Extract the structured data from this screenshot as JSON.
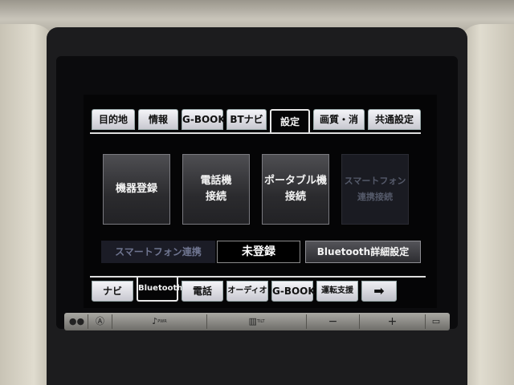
{
  "top_tabs": [
    {
      "label": "目的地",
      "active": false
    },
    {
      "label": "情報",
      "active": false
    },
    {
      "label": "G-BOOK",
      "active": false
    },
    {
      "label": "BTナビ",
      "active": false
    },
    {
      "label": "設定",
      "active": true
    },
    {
      "label": "画質・消",
      "active": false
    },
    {
      "label": "共通設定",
      "active": false
    }
  ],
  "main_buttons": [
    {
      "label": "機器登録",
      "enabled": true
    },
    {
      "label": "電話機\n接続",
      "enabled": true
    },
    {
      "label": "ポータブル機\n接続",
      "enabled": true
    },
    {
      "label": "スマートフォン\n連携接続",
      "enabled": false
    }
  ],
  "status": {
    "label": "スマートフォン連携",
    "value": "未登録",
    "detail_button": "Bluetooth詳細設定"
  },
  "bottom_tabs": [
    {
      "label": "ナビ",
      "active": false
    },
    {
      "label": "Bluetooth",
      "active": true
    },
    {
      "label": "電話",
      "active": false
    },
    {
      "label": "オーディオ",
      "active": false
    },
    {
      "label": "G-BOOK",
      "active": false
    },
    {
      "label": "運転支援",
      "active": false
    },
    {
      "label": "➡",
      "active": false
    }
  ],
  "hardware": {
    "power_icon": "power-icon",
    "home_icon": "home-icon",
    "music_icon": "music-note-icon",
    "music_sub": "PWR",
    "tilt_sub": "TILT",
    "minus": "−",
    "plus": "+"
  },
  "colors": {
    "accent_active": "#050506",
    "tab_light": "#f4f4f8",
    "disabled_text": "#555a6a"
  }
}
